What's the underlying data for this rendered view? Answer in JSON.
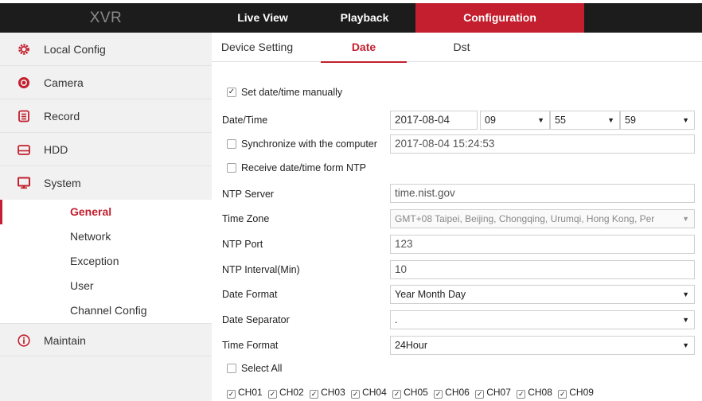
{
  "app": {
    "logo": "XVR"
  },
  "topnav": {
    "live": "Live View",
    "playback": "Playback",
    "config": "Configuration"
  },
  "sidebar": {
    "items": [
      {
        "label": "Local Config",
        "icon": "gear-icon"
      },
      {
        "label": "Camera",
        "icon": "camera-icon"
      },
      {
        "label": "Record",
        "icon": "record-icon"
      },
      {
        "label": "HDD",
        "icon": "hdd-icon"
      },
      {
        "label": "System",
        "icon": "monitor-icon"
      }
    ],
    "sub": [
      "General",
      "Network",
      "Exception",
      "User",
      "Channel Config"
    ],
    "active_sub": "General",
    "maintain": {
      "label": "Maintain",
      "icon": "info-icon"
    }
  },
  "tabs": {
    "device": "Device Setting",
    "date": "Date",
    "dst": "Dst",
    "active": "Date"
  },
  "form": {
    "manual": {
      "label": "Set date/time manually",
      "checked": true
    },
    "datetime": {
      "label": "Date/Time",
      "date": "2017-08-04",
      "hour": "09",
      "minute": "55",
      "second": "59"
    },
    "sync": {
      "label": "Synchronize with the computer",
      "checked": false,
      "computer_time": "2017-08-04 15:24:53"
    },
    "ntp_receive": {
      "label": "Receive date/time form NTP",
      "checked": false
    },
    "ntp_server": {
      "label": "NTP Server",
      "value": "time.nist.gov"
    },
    "time_zone": {
      "label": "Time Zone",
      "value": "GMT+08 Taipei, Beijing, Chongqing, Urumqi, Hong Kong, Per"
    },
    "ntp_port": {
      "label": "NTP Port",
      "value": "123"
    },
    "ntp_interval": {
      "label": "NTP Interval(Min)",
      "value": "10"
    },
    "date_format": {
      "label": "Date Format",
      "value": "Year Month Day"
    },
    "date_separator": {
      "label": "Date Separator",
      "value": "."
    },
    "time_format": {
      "label": "Time Format",
      "value": "24Hour"
    },
    "select_all": {
      "label": "Select All",
      "checked": false
    },
    "channels": [
      "CH01",
      "CH02",
      "CH03",
      "CH04",
      "CH05",
      "CH06",
      "CH07",
      "CH08",
      "CH09"
    ]
  },
  "colors": {
    "accent": "#c31f2e",
    "topbar": "#1c1c1c",
    "sidebar": "#f1f1f1"
  }
}
